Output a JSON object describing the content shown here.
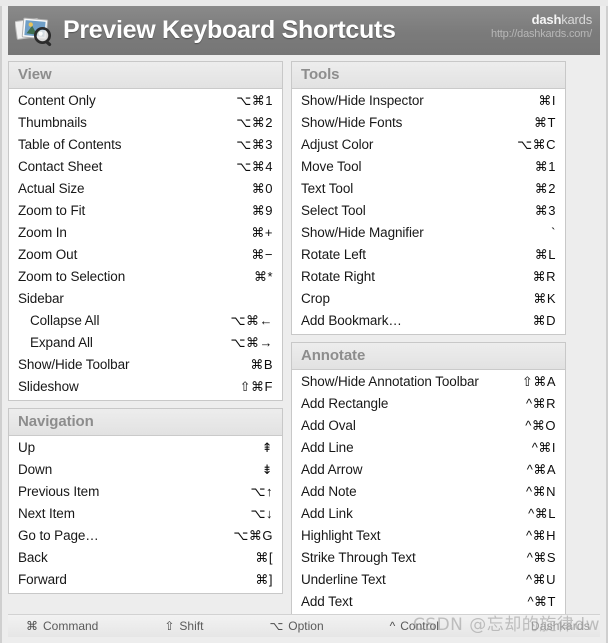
{
  "header": {
    "title": "Preview Keyboard Shortcuts",
    "app_icon": "preview-app-icon",
    "brand_bold": "dash",
    "brand_rest": "kards",
    "brand_url": "http://dashkards.com/"
  },
  "left_column": {
    "sections": [
      {
        "title": "View",
        "rows": [
          {
            "label": "Content Only",
            "keys": "⌥⌘1",
            "indent": false
          },
          {
            "label": "Thumbnails",
            "keys": "⌥⌘2",
            "indent": false
          },
          {
            "label": "Table of Contents",
            "keys": "⌥⌘3",
            "indent": false
          },
          {
            "label": "Contact Sheet",
            "keys": "⌥⌘4",
            "indent": false
          },
          {
            "label": "Actual Size",
            "keys": "⌘0",
            "indent": false
          },
          {
            "label": "Zoom to Fit",
            "keys": "⌘9",
            "indent": false
          },
          {
            "label": "Zoom In",
            "keys": "⌘+",
            "indent": false
          },
          {
            "label": "Zoom Out",
            "keys": "⌘−",
            "indent": false
          },
          {
            "label": "Zoom to Selection",
            "keys": "⌘*",
            "indent": false
          },
          {
            "label": "Sidebar",
            "keys": "",
            "indent": false
          },
          {
            "label": "Collapse All",
            "keys": "⌥⌘←",
            "indent": true
          },
          {
            "label": "Expand All",
            "keys": "⌥⌘→",
            "indent": true
          },
          {
            "label": "Show/Hide Toolbar",
            "keys": "⌘B",
            "indent": false
          },
          {
            "label": "Slideshow",
            "keys": "⇧⌘F",
            "indent": false
          }
        ]
      },
      {
        "title": "Navigation",
        "rows": [
          {
            "label": "Up",
            "keys": "⇞",
            "indent": false
          },
          {
            "label": "Down",
            "keys": "⇟",
            "indent": false
          },
          {
            "label": "Previous Item",
            "keys": "⌥↑",
            "indent": false
          },
          {
            "label": "Next Item",
            "keys": "⌥↓",
            "indent": false
          },
          {
            "label": "Go to Page…",
            "keys": "⌥⌘G",
            "indent": false
          },
          {
            "label": "Back",
            "keys": "⌘[",
            "indent": false
          },
          {
            "label": "Forward",
            "keys": "⌘]",
            "indent": false
          }
        ]
      }
    ]
  },
  "right_column": {
    "sections": [
      {
        "title": "Tools",
        "rows": [
          {
            "label": "Show/Hide Inspector",
            "keys": "⌘I",
            "indent": false
          },
          {
            "label": "Show/Hide Fonts",
            "keys": "⌘T",
            "indent": false
          },
          {
            "label": "Adjust Color",
            "keys": "⌥⌘C",
            "indent": false
          },
          {
            "label": "Move Tool",
            "keys": "⌘1",
            "indent": false
          },
          {
            "label": "Text Tool",
            "keys": "⌘2",
            "indent": false
          },
          {
            "label": "Select Tool",
            "keys": "⌘3",
            "indent": false
          },
          {
            "label": "Show/Hide Magnifier",
            "keys": "`",
            "indent": false
          },
          {
            "label": "Rotate Left",
            "keys": "⌘L",
            "indent": false
          },
          {
            "label": "Rotate Right",
            "keys": "⌘R",
            "indent": false
          },
          {
            "label": "Crop",
            "keys": "⌘K",
            "indent": false
          },
          {
            "label": "Add Bookmark…",
            "keys": "⌘D",
            "indent": false
          }
        ]
      },
      {
        "title": "Annotate",
        "rows": [
          {
            "label": "Show/Hide Annotation Toolbar",
            "keys": "⇧⌘A",
            "indent": false
          },
          {
            "label": "Add Rectangle",
            "keys": "^⌘R",
            "indent": false
          },
          {
            "label": "Add Oval",
            "keys": "^⌘O",
            "indent": false
          },
          {
            "label": "Add Line",
            "keys": "^⌘I",
            "indent": false
          },
          {
            "label": "Add Arrow",
            "keys": "^⌘A",
            "indent": false
          },
          {
            "label": "Add Note",
            "keys": "^⌘N",
            "indent": false
          },
          {
            "label": "Add Link",
            "keys": "^⌘L",
            "indent": false
          },
          {
            "label": "Highlight Text",
            "keys": "^⌘H",
            "indent": false
          },
          {
            "label": "Strike Through Text",
            "keys": "^⌘S",
            "indent": false
          },
          {
            "label": "Underline Text",
            "keys": "^⌘U",
            "indent": false
          },
          {
            "label": "Add Text",
            "keys": "^⌘T",
            "indent": false
          }
        ]
      }
    ]
  },
  "footer": {
    "legend": [
      {
        "glyph": "⌘",
        "name": "Command"
      },
      {
        "glyph": "⇧",
        "name": "Shift"
      },
      {
        "glyph": "⌥",
        "name": "Option"
      },
      {
        "glyph": "^",
        "name": "Control"
      }
    ],
    "brand": "Dashkards"
  },
  "watermark": {
    "text": "CSDN @忘却的旋律dw"
  },
  "colors": {
    "header_bg": "#7b7b7b",
    "card_bg": "#ededed",
    "section_header_bg": "#e7e7e7",
    "section_border": "#c8c8c8",
    "row_text": "#181818",
    "section_title_text": "#8d8d8d"
  }
}
